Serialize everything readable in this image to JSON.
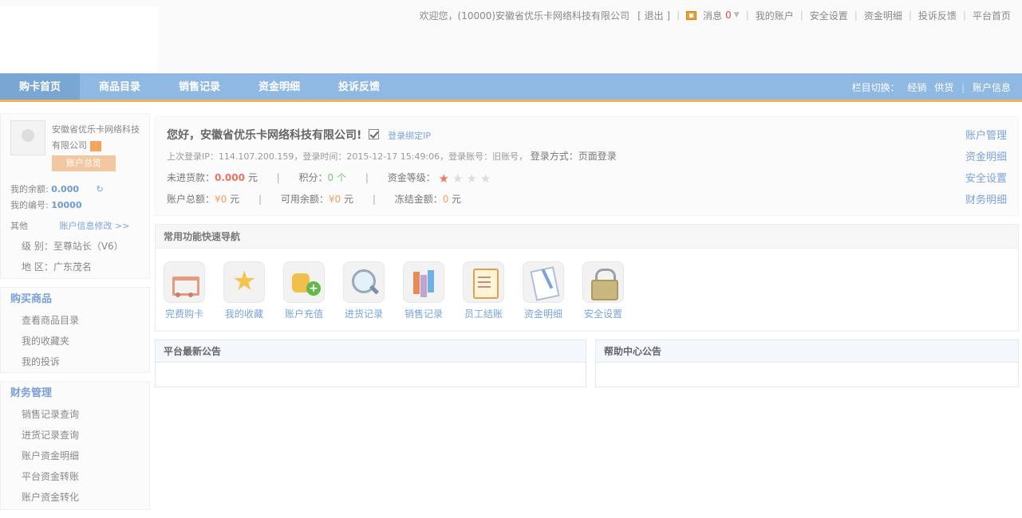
{
  "header": {
    "welcome": "欢迎您，(10000)安徽省优乐卡网络科技有限公司",
    "logout": "[ 退出 ]",
    "messages_label": "消息",
    "messages_count": "0",
    "links": [
      "我的账户",
      "安全设置",
      "资金明细",
      "投诉反馈",
      "平台首页"
    ]
  },
  "nav": {
    "tabs": [
      "购卡首页",
      "商品目录",
      "销售记录",
      "资金明细",
      "投诉反馈"
    ],
    "switch_label": "栏目切换：",
    "switch_options": [
      "经销",
      "供货"
    ],
    "account_info": "账户信息"
  },
  "sidebar": {
    "company_name": "安徽省优乐卡网络科技有限公司",
    "account_button": "账户总览",
    "balance_label": "我的余额:",
    "balance_value": "0.000",
    "number_label": "我的编号:",
    "number_value": "10000",
    "other_label": "其他",
    "edit_link": "账户信息修改 >>",
    "level": "级 别：至尊站长（V6）",
    "region": "地 区：广东茂名",
    "sections": [
      {
        "title": "购买商品",
        "items": [
          "查看商品目录",
          "我的收藏夹",
          "我的投诉"
        ]
      },
      {
        "title": "财务管理",
        "items": [
          "销售记录查询",
          "进货记录查询",
          "账户资金明细",
          "平台资金转账",
          "账户资金转化"
        ]
      }
    ]
  },
  "welcome": {
    "greeting": "您好，安徽省优乐卡网络科技有限公司!",
    "bind_link": "登录绑定IP",
    "last_login": "上次登录IP：114.107.200.159，登录时间：2015-12-17 15:49:06，登录账号：旧账号，",
    "login_method": "登录方式：页面登录",
    "unsettled_label": "未进货款：",
    "unsettled_value": "0.000",
    "unsettled_unit": "元",
    "points_label": "积分：",
    "points_value": "0 个",
    "credit_label": "资金等级：",
    "total_label": "账户总额：",
    "total_value": "¥0",
    "total_unit": "元",
    "available_label": "可用余额：",
    "available_value": "¥0",
    "available_unit": "元",
    "frozen_label": "冻结金额：",
    "frozen_value": "0",
    "frozen_unit": "元",
    "quick_links": [
      "账户管理",
      "资金明细",
      "安全设置",
      "财务明细"
    ],
    "rating": 1,
    "rating_max": 4
  },
  "fast_nav": {
    "title": "常用功能快速导航",
    "items": [
      {
        "label": "完费购卡",
        "icon": "cart-icon"
      },
      {
        "label": "我的收藏",
        "icon": "star-icon"
      },
      {
        "label": "账户充值",
        "icon": "coins-add-icon"
      },
      {
        "label": "进货记录",
        "icon": "magnifier-icon"
      },
      {
        "label": "销售记录",
        "icon": "bar-chart-icon"
      },
      {
        "label": "员工结账",
        "icon": "memo-icon"
      },
      {
        "label": "资金明细",
        "icon": "document-icon"
      },
      {
        "label": "安全设置",
        "icon": "lock-icon"
      }
    ]
  },
  "notices": {
    "platform_title": "平台最新公告",
    "help_title": "帮助中心公告"
  },
  "colors": {
    "nav_bg": "#8fb9e3",
    "nav_accent": "#f0b35a",
    "link_blue": "#7aa3da",
    "value_red": "#f07060"
  }
}
